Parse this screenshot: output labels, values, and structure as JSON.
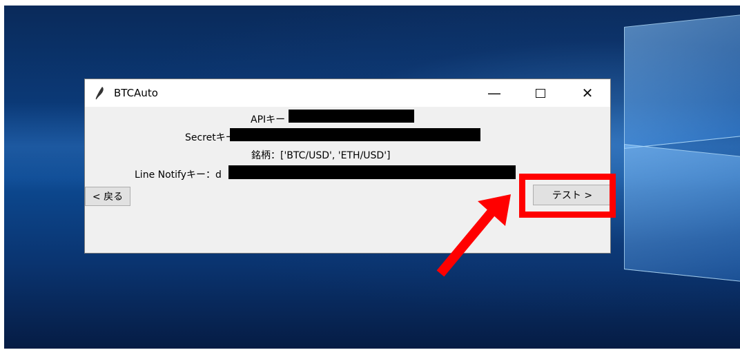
{
  "window": {
    "title": "BTCAuto",
    "minimize_glyph": "—",
    "close_glyph": "✕"
  },
  "fields": {
    "api_key_label": "APIキー",
    "secret_key_label": "Secretキー",
    "symbols_text": "銘柄：['BTC/USD', 'ETH/USD']",
    "line_notify_label": "Line Notifyキー：d"
  },
  "buttons": {
    "back_label": "< 戻る",
    "test_label": "テスト >"
  },
  "annotation": {
    "color": "#ff0000"
  },
  "icons": [
    "feather-icon",
    "minimize-icon",
    "maximize-icon",
    "close-icon",
    "arrow-annotation-icon"
  ]
}
